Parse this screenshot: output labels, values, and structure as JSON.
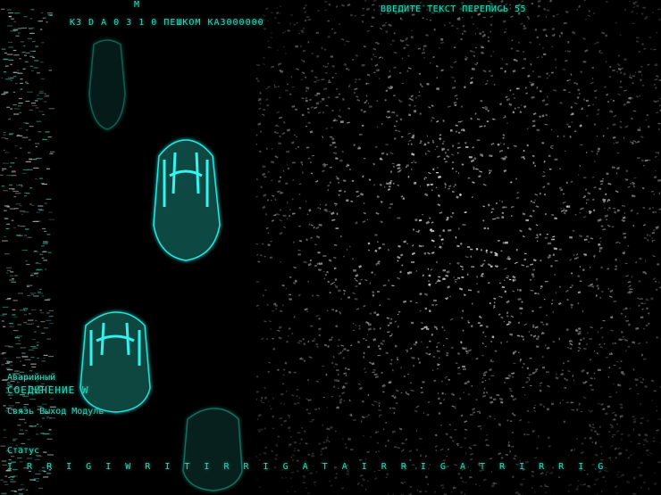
{
  "screen": {
    "top_marker": "M",
    "title_line": "K3 D A 0 3 1 0 ПЕШКОМ КАЗ000000",
    "header_line": "ВВЕДИТЕ ТЕКСТ ПЕРЕПИСЬ 55",
    "status_1": "Аварийный",
    "status_2": "СОЕДИНЕНИЕ W",
    "status_3": "Связь Выход Модуль",
    "status_4": "Статус",
    "bottom_line": "I R R I G I W R I T   I R R I G A T   A I R R I G A T   R I R R I G",
    "footer_line": ""
  },
  "colors": {
    "accent": "#2fd6b7",
    "glow": "#25f0e0",
    "dim": "#0f5c52",
    "background": "#000000"
  },
  "icons": [
    "robot-figure-icon",
    "robot-figure-icon",
    "robot-figure-icon",
    "robot-figure-icon"
  ]
}
